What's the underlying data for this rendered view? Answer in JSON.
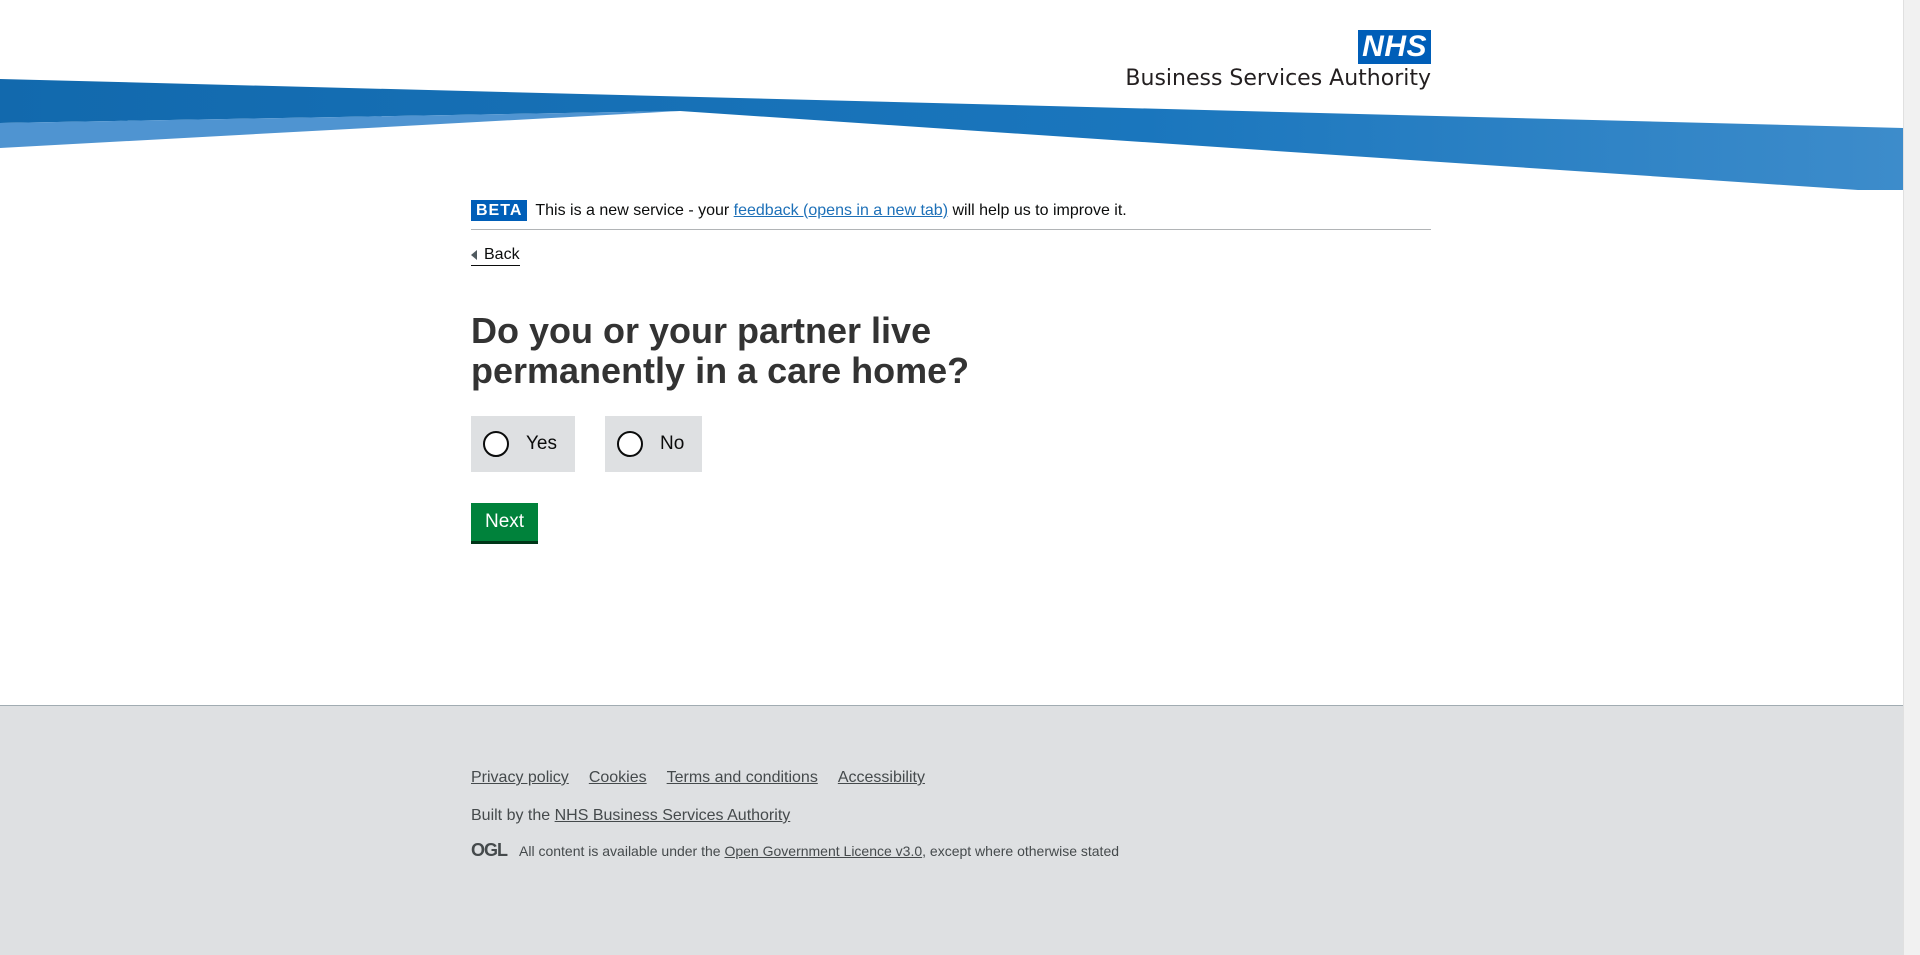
{
  "header": {
    "logo_text": "NHS",
    "org_name": "Business Services Authority",
    "colors": {
      "brand_blue": "#005eb8",
      "band_dark": "#0f6fb4",
      "band_light": "#4e95d0"
    }
  },
  "phase_banner": {
    "tag": "BETA",
    "text_before": "This is a new service - your ",
    "link": "feedback (opens in a new tab)",
    "text_after": " will help us to improve it."
  },
  "back_link": "Back",
  "question": "Do you or your partner live permanently in a care home?",
  "radios": [
    {
      "label": "Yes",
      "selected": false
    },
    {
      "label": "No",
      "selected": false
    }
  ],
  "next_button": "Next",
  "footer": {
    "links": [
      "Privacy policy",
      "Cookies",
      "Terms and conditions",
      "Accessibility"
    ],
    "built_by_prefix": "Built by the ",
    "built_by_link": "NHS Business Services Authority",
    "licence_logo": "OGL",
    "licence_prefix": "All content is available under the ",
    "licence_link": "Open Government Licence v3.0",
    "licence_suffix": ", except where otherwise stated"
  },
  "colors": {
    "button_green": "#00823b",
    "link_blue": "#1d70b8",
    "footer_bg": "#dee0e2",
    "radio_bg": "#dee0e2"
  }
}
